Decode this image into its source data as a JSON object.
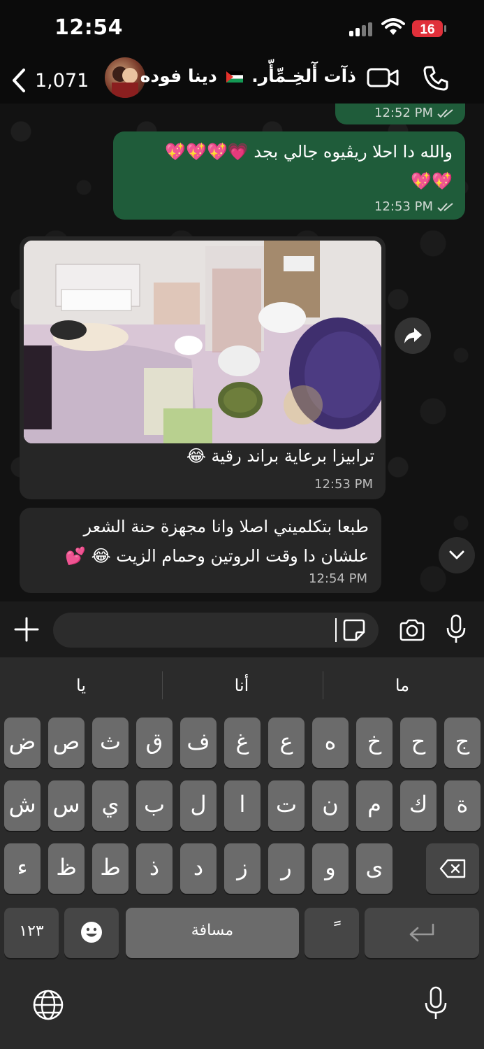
{
  "status_bar": {
    "time": "12:54",
    "battery": "16"
  },
  "header": {
    "back_count": "1,071",
    "contact_name_part1": "ذآت أٓلخِـمِّأّر.",
    "contact_name_part2": "دينا فوده"
  },
  "messages": [
    {
      "direction": "out",
      "text": "",
      "time": "12:52 PM",
      "read": true
    },
    {
      "direction": "out",
      "text_line1": "والله دا احلا ريڤيوه جالي بجد 💗💖💖💖",
      "text_line2": "💖💖",
      "time": "12:53 PM",
      "read": true
    },
    {
      "direction": "in",
      "type": "photo",
      "caption": "ترابيزا برعاية براند رقية 😂",
      "time": "12:53 PM"
    },
    {
      "direction": "in",
      "text_line1": "طبعا بتكلميني اصلا وانا مجهزة حنة الشعر",
      "text_line2": "علشان دا وقت الروتين وحمام الزيت  😂 💕",
      "time": "12:54 PM"
    }
  ],
  "keyboard": {
    "suggestions": [
      "يا",
      "أنا",
      "ما"
    ],
    "row1": [
      "ض",
      "ص",
      "ث",
      "ق",
      "ف",
      "غ",
      "ع",
      "ه",
      "خ",
      "ح",
      "ج"
    ],
    "row2": [
      "ش",
      "س",
      "ي",
      "ب",
      "ل",
      "ا",
      "ت",
      "ن",
      "م",
      "ك",
      "ة"
    ],
    "row3": [
      "ء",
      "ظ",
      "ط",
      "ذ",
      "د",
      "ز",
      "ر",
      "و",
      "ى"
    ],
    "numbers_key": "١٢٣",
    "space_label": "مسافة",
    "tanween_key": "ً"
  },
  "colors": {
    "outgoing_bubble": "#1f5c3a",
    "incoming_bubble": "#262626",
    "battery_badge": "#e0303a"
  }
}
